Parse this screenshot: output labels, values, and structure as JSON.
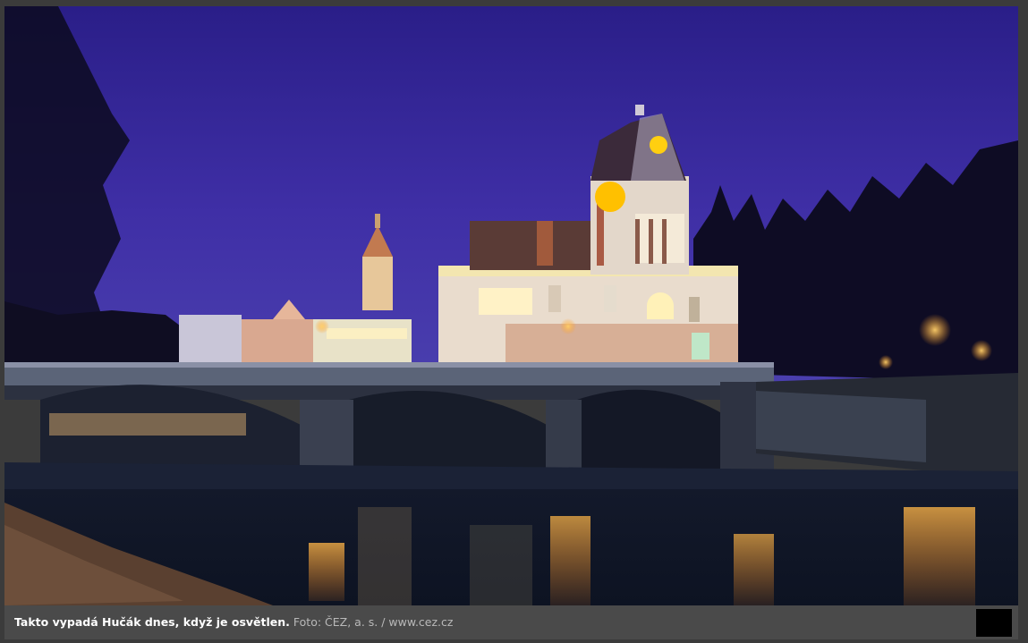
{
  "caption": {
    "text": "Takto vypadá Hučák dnes, když je osvětlen.",
    "credit": "Foto: ČEZ, a. s. / www.cez.cz"
  },
  "colors": {
    "sky_top": "#2b1f86",
    "sky_bottom": "#4a3aa8",
    "caption_bg": "#4a4a4a",
    "frame": "#3b3b3b",
    "light": "#ffb030"
  }
}
